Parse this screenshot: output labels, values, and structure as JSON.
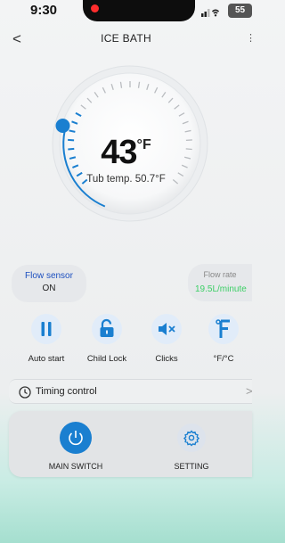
{
  "status_bar": {
    "time": "9:30",
    "battery": "55"
  },
  "header": {
    "back_glyph": "<",
    "title": "ICE BATH",
    "right_glyph": "⋮"
  },
  "dial": {
    "set_temperature": "43",
    "unit": "°F",
    "tub_temp_text": "Tub temp. 50.7°F",
    "accent_color": "#1a7fd0"
  },
  "flow_sensor": {
    "label": "Flow sensor",
    "value": "ON"
  },
  "flow_rate": {
    "label": "Flow rate",
    "value": "19.5L/minute"
  },
  "controls": [
    {
      "label": "Auto start",
      "icon": "pause-icon"
    },
    {
      "label": "Child Lock",
      "icon": "unlock-icon"
    },
    {
      "label": "Clicks",
      "icon": "mute-icon"
    },
    {
      "label": "°F/°C",
      "icon": "fahrenheit-icon"
    }
  ],
  "timing": {
    "label": "Timing control",
    "arrow": ">"
  },
  "bottom": {
    "main_switch_label": "MAIN SWITCH",
    "setting_label": "SETTING"
  }
}
